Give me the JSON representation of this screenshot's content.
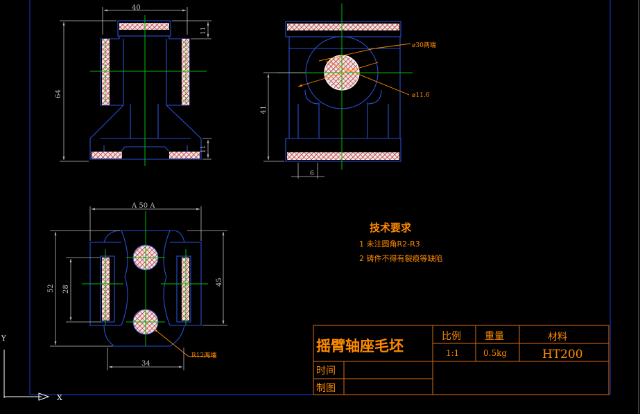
{
  "colors": {
    "background": "#000000",
    "outline": "#2a4fd6",
    "center": "#00c000",
    "dimension": "#c0c0c0",
    "hatch": "#cc2222",
    "hatch_fill": "#e8e8e8",
    "title_block": "#e06a10",
    "text_orange": "#ff8a00",
    "leader": "#ff8a00",
    "frame": "#1c3bd4",
    "ucs": "#ffffff"
  },
  "front_view": {
    "dim_top": "40",
    "dim_left": "64",
    "dim_right_top": "11",
    "dim_right_bottom": "11"
  },
  "side_view": {
    "dim_left": "41",
    "dim_bottom": "6",
    "hole_large": "⌀30两端",
    "hole_small": "⌀11.6"
  },
  "plan_view": {
    "dim_top": "A 50 A",
    "dim_left_outer": "52",
    "dim_left_inner": "28",
    "dim_right": "45",
    "dim_bottom": "34",
    "radius_note": "R12两端"
  },
  "tech_requirements": {
    "title": "技术要求",
    "items": [
      "1 未注圆角R2-R3",
      "2 铸件不得有裂痕等缺陷"
    ]
  },
  "title_block": {
    "part_name": "摇臂轴座毛坯",
    "scale_label": "比例",
    "weight_label": "重量",
    "material_label": "材料",
    "scale_value": "1:1",
    "weight_value": "0.5kg",
    "material_value": "HT200",
    "time_label": "时间",
    "drawn_label": "制图"
  },
  "ucs": {
    "x_label": "X",
    "y_label": "Y"
  }
}
